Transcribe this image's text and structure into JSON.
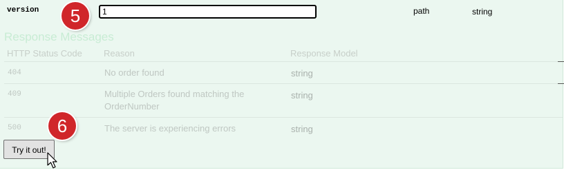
{
  "parameter": {
    "name": "version",
    "value": "1",
    "in": "path",
    "type": "string"
  },
  "badges": [
    "5",
    "6"
  ],
  "responses": {
    "title": "Response Messages",
    "headers": [
      "HTTP Status Code",
      "Reason",
      "Response Model"
    ],
    "rows": [
      {
        "code": "404",
        "reason": "No order found",
        "model": "string"
      },
      {
        "code": "409",
        "reason": "Multiple Orders found matching the OrderNumber",
        "model": "string"
      },
      {
        "code": "500",
        "reason": "The server is experiencing errors",
        "model": "string"
      }
    ]
  },
  "try_button": {
    "label": "Try it out!"
  },
  "colors": {
    "panel_bg": "#ebf7f0",
    "badge": "#d0262a",
    "section_title": "#c8ecd4",
    "muted_text": "#bfc7c2"
  }
}
